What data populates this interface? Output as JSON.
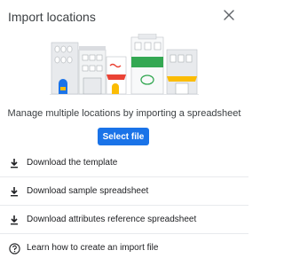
{
  "dialog": {
    "title": "Import locations",
    "subtitle": "Manage multiple locations by importing a spreadsheet",
    "primary_button": "Select file"
  },
  "actions": [
    {
      "label": "Download the template",
      "icon": "download-icon"
    },
    {
      "label": "Download sample spreadsheet",
      "icon": "download-icon"
    },
    {
      "label": "Download attributes reference spreadsheet",
      "icon": "download-icon"
    },
    {
      "label": "Learn how to create an import file",
      "icon": "help-circle-icon"
    }
  ],
  "colors": {
    "accent": "#1a73e8",
    "text": "#202124",
    "divider": "#e8eaed"
  }
}
